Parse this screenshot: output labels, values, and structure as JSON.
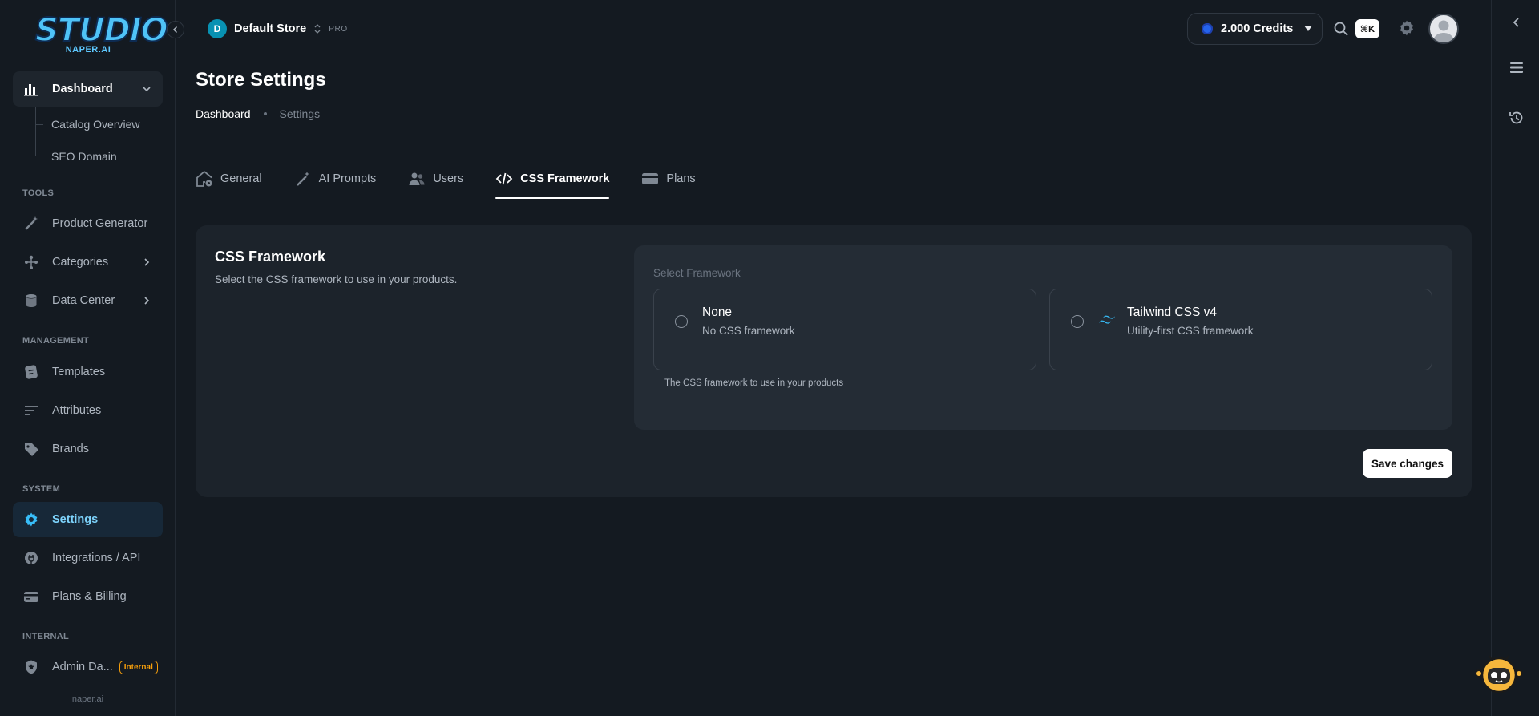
{
  "app": {
    "logo_text": "STUDIO",
    "logo_sub": "NAPER.AI",
    "footer": "naper.ai"
  },
  "sidebar": {
    "dashboard": "Dashboard",
    "sub_items": [
      "Catalog Overview",
      "SEO Domain"
    ],
    "sections": {
      "tools": "TOOLS",
      "management": "MANAGEMENT",
      "system": "SYSTEM",
      "internal": "INTERNAL"
    },
    "items": {
      "product_generator": "Product Generator",
      "categories": "Categories",
      "data_center": "Data Center",
      "templates": "Templates",
      "attributes": "Attributes",
      "brands": "Brands",
      "settings": "Settings",
      "integrations": "Integrations / API",
      "plans_billing": "Plans & Billing",
      "admin": "Admin Da...",
      "admin_badge": "Internal"
    }
  },
  "header": {
    "store_initial": "D",
    "store_name": "Default Store",
    "store_plan": "PRO",
    "credits": "2.000 Credits",
    "shortcut": "⌘K"
  },
  "page": {
    "title": "Store Settings",
    "breadcrumb": [
      "Dashboard",
      "Settings"
    ]
  },
  "tabs": [
    "General",
    "AI Prompts",
    "Users",
    "CSS Framework",
    "Plans"
  ],
  "active_tab": "CSS Framework",
  "card": {
    "title": "CSS Framework",
    "description": "Select the CSS framework to use in your products.",
    "select_label": "Select Framework",
    "options": [
      {
        "name": "None",
        "description": "No CSS framework",
        "selected": false
      },
      {
        "name": "Tailwind CSS v4",
        "description": "Utility-first CSS framework",
        "selected": false
      }
    ],
    "helper": "The CSS framework to use in your products",
    "save_label": "Save changes"
  },
  "colors": {
    "accent": "#38bdf8",
    "background": "#141a21",
    "card": "#1c232b",
    "tailwind": "#38bdf8",
    "internal_badge": "#f59e0b"
  }
}
